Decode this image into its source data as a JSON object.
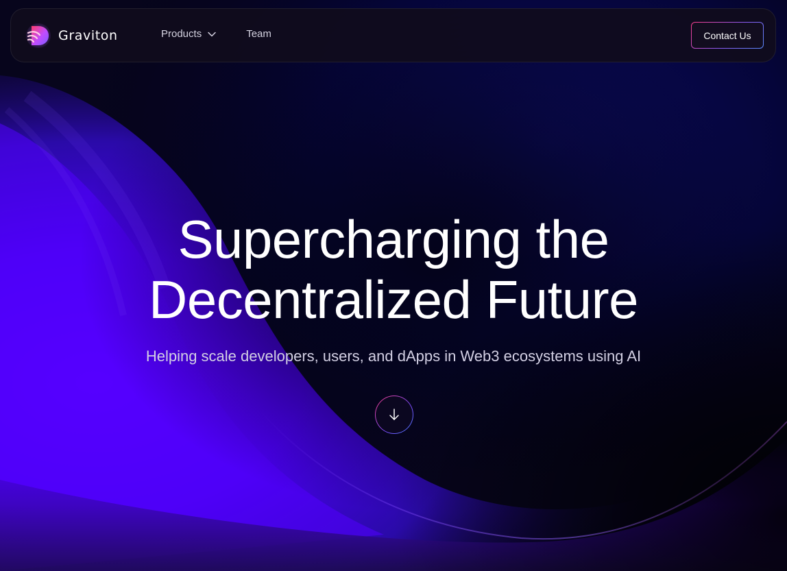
{
  "nav": {
    "brand_name": "Graviton",
    "brand_icon": "graviton-logo",
    "links": [
      {
        "label": "Products",
        "icon": "chevron-down-icon"
      },
      {
        "label": "Team"
      }
    ],
    "cta_label": "Contact Us"
  },
  "hero": {
    "title_line1": "Supercharging the",
    "title_line2": "Decentralized Future",
    "subtitle": "Helping scale developers, users, and dApps in Web3 ecosystems using AI",
    "scroll_icon": "arrow-down-icon"
  },
  "colors": {
    "background": "#07051a",
    "accent_purple": "#5200ff",
    "accent_pink": "#ff3d8b",
    "accent_blue": "#5b8cff",
    "text_primary": "#ffffff",
    "text_secondary": "#d3d0e4"
  }
}
